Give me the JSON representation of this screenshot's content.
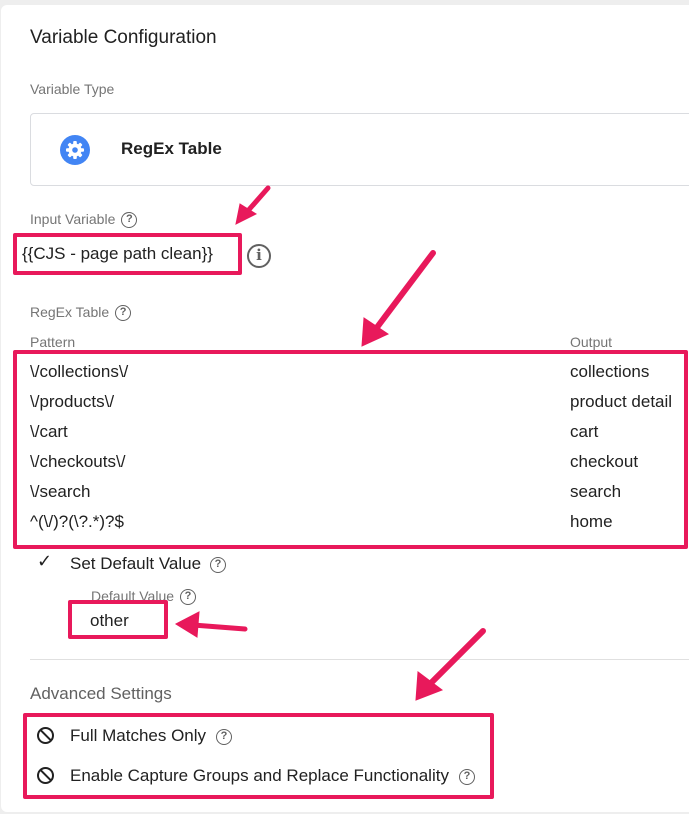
{
  "header": {
    "title": "Variable Configuration"
  },
  "variable_type": {
    "label": "Variable Type",
    "type_name": "RegEx Table",
    "icon": "gear-icon"
  },
  "input_variable": {
    "label": "Input Variable",
    "value": "{{CJS - page path clean}}",
    "help_icon": "question-circle-icon",
    "info_icon": "info-icon"
  },
  "regex_table": {
    "label": "RegEx Table",
    "columns": [
      "Pattern",
      "Output"
    ],
    "rows": [
      {
        "pattern": "\\/collections\\/",
        "output": "collections"
      },
      {
        "pattern": "\\/products\\/",
        "output": "product detail"
      },
      {
        "pattern": "\\/cart",
        "output": "cart"
      },
      {
        "pattern": "\\/checkouts\\/",
        "output": "checkout"
      },
      {
        "pattern": "\\/search",
        "output": "search"
      },
      {
        "pattern": "^(\\/)?(\\?.*)?$",
        "output": "home"
      }
    ]
  },
  "default_value": {
    "checkbox_label": "Set Default Value",
    "checked": true,
    "field_label": "Default Value",
    "value": "other"
  },
  "advanced": {
    "title": "Advanced Settings",
    "options": [
      {
        "label": "Full Matches Only",
        "enabled": false
      },
      {
        "label": "Enable Capture Groups and Replace Functionality",
        "enabled": false
      }
    ]
  },
  "colors": {
    "highlight": "#e8195b",
    "accent": "#4285f4"
  }
}
